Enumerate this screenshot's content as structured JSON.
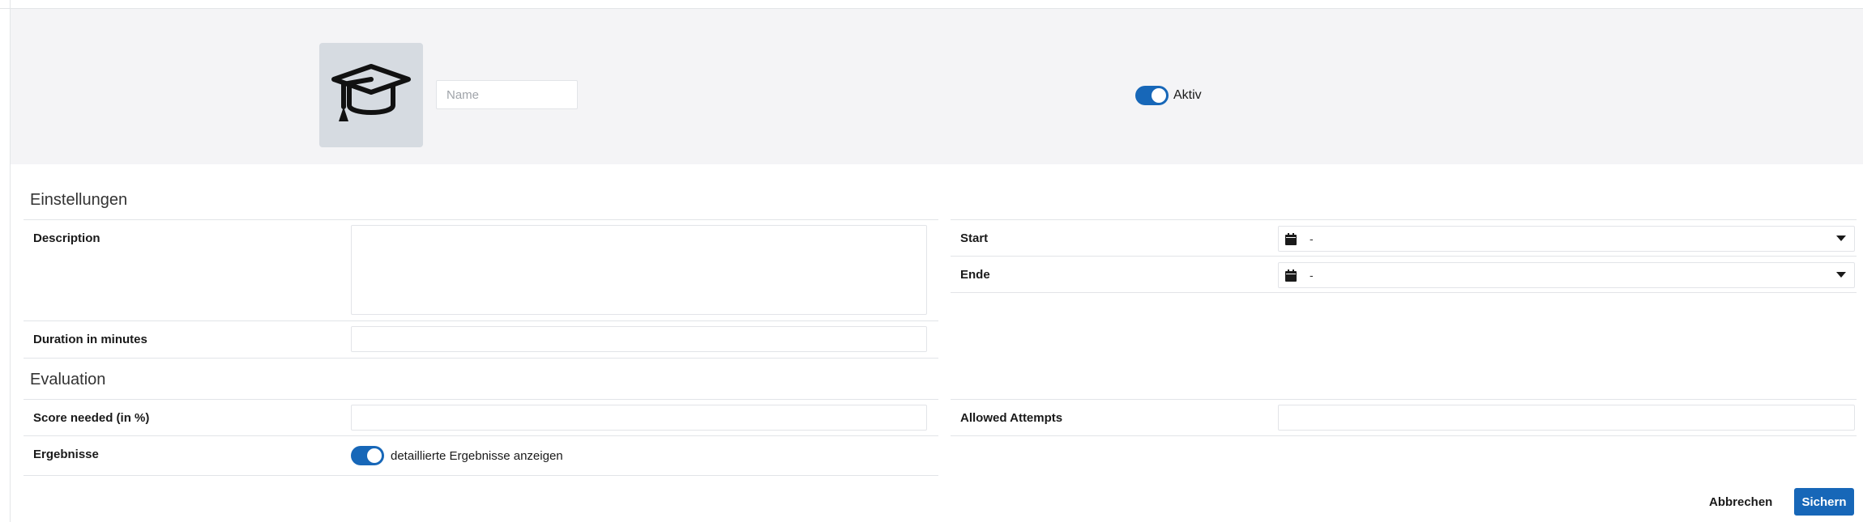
{
  "header": {
    "avatar_icon": "graduation-cap-icon",
    "name_placeholder": "Name",
    "name_value": "",
    "active_toggle": {
      "label": "Aktiv",
      "on": true
    }
  },
  "settings": {
    "title": "Einstellungen",
    "description_label": "Description",
    "description_value": "",
    "duration_label": "Duration in minutes",
    "duration_value": "",
    "start_label": "Start",
    "start_value": "-",
    "end_label": "Ende",
    "end_value": "-"
  },
  "evaluation": {
    "title": "Evaluation",
    "score_label": "Score needed (in %)",
    "score_value": "",
    "attempts_label": "Allowed Attempts",
    "attempts_value": "",
    "results_label": "Ergebnisse",
    "results_toggle": {
      "label": "detaillierte Ergebnisse anzeigen",
      "on": true
    }
  },
  "footer": {
    "cancel_label": "Abbrechen",
    "save_label": "Sichern"
  },
  "colors": {
    "accent": "#1767b8",
    "header_bg": "#f4f4f6",
    "avatar_bg": "#d6dbe1"
  }
}
